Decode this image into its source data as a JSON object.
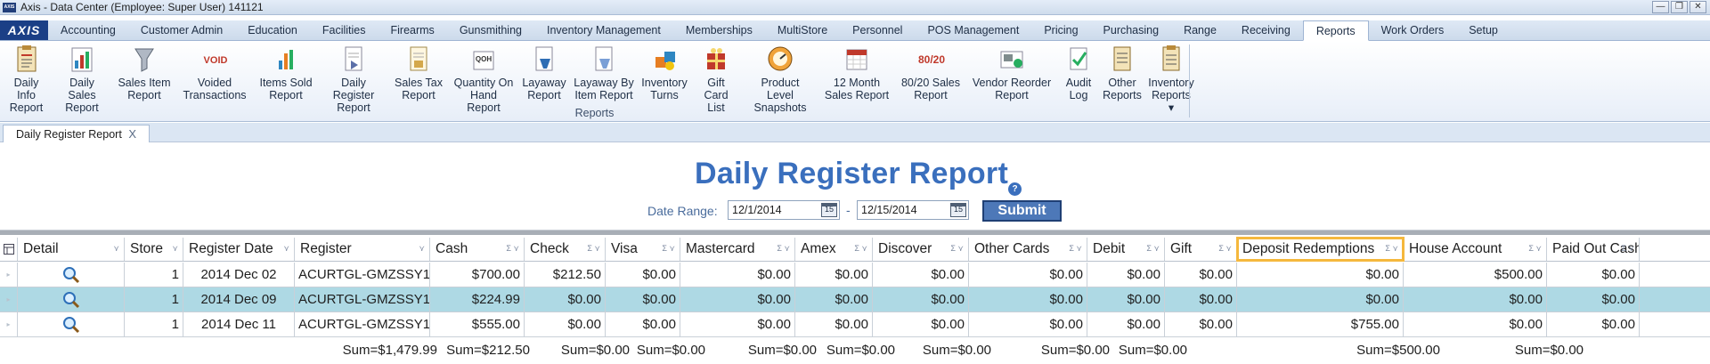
{
  "window": {
    "title": "Axis - Data Center  (Employee: Super User) 141121",
    "app_icon_text": "AXIS",
    "buttons": [
      "—",
      "❐",
      "✕"
    ]
  },
  "menu": {
    "logo": "AXIS",
    "tabs": [
      "Accounting",
      "Customer Admin",
      "Education",
      "Facilities",
      "Firearms",
      "Gunsmithing",
      "Inventory Management",
      "Memberships",
      "MultiStore",
      "Personnel",
      "POS Management",
      "Pricing",
      "Purchasing",
      "Range",
      "Receiving",
      "Reports",
      "Work Orders",
      "Setup"
    ],
    "active_tab": "Reports"
  },
  "ribbon": {
    "group_label": "Reports",
    "items": [
      {
        "label": "Daily Info\nReport",
        "icon": "report-clipboard-icon"
      },
      {
        "label": "Daily Sales\nReport",
        "icon": "bar-chart-icon"
      },
      {
        "label": "Sales Item\nReport",
        "icon": "funnel-icon"
      },
      {
        "label": "Voided\nTransactions",
        "icon": "void-stamp-icon",
        "icon_text": "VOID"
      },
      {
        "label": "Items Sold\nReport",
        "icon": "items-chart-icon"
      },
      {
        "label": "Daily Register\nReport",
        "icon": "register-document-icon"
      },
      {
        "label": "Sales Tax\nReport",
        "icon": "tax-document-icon"
      },
      {
        "label": "Quantity On\nHand Report",
        "icon": "qoh-icon",
        "icon_text": "QOH"
      },
      {
        "label": "Layaway\nReport",
        "icon": "layaway-icon"
      },
      {
        "label": "Layaway By\nItem Report",
        "icon": "layaway-item-icon"
      },
      {
        "label": "Inventory\nTurns",
        "icon": "inventory-turns-icon"
      },
      {
        "label": "Gift Card\nList",
        "icon": "gift-card-icon"
      },
      {
        "label": "Product Level\nSnapshots",
        "icon": "snapshot-gauge-icon"
      },
      {
        "label": "12 Month\nSales Report",
        "icon": "calendar-icon"
      },
      {
        "label": "80/20 Sales\nReport",
        "icon": "eighty-twenty-icon",
        "icon_text": "80/20"
      },
      {
        "label": "Vendor Reorder\nReport",
        "icon": "vendor-reorder-icon"
      },
      {
        "label": "Audit\nLog",
        "icon": "audit-check-icon"
      },
      {
        "label": "Other\nReports",
        "icon": "other-reports-icon"
      },
      {
        "label": "Inventory\nReports ▾",
        "icon": "inventory-reports-icon"
      }
    ]
  },
  "doc_tab": {
    "label": "Daily Register Report",
    "close": "X"
  },
  "report": {
    "title": "Daily Register Report",
    "help": "?",
    "date_range_label": "Date Range:",
    "date_from": "12/1/2014",
    "date_to": "12/15/2014",
    "calendar_day": "15",
    "dash": "-",
    "submit": "Submit"
  },
  "grid": {
    "columns": [
      "Detail",
      "Store",
      "Register Date",
      "Register",
      "Cash",
      "Check",
      "Visa",
      "Mastercard",
      "Amex",
      "Discover",
      "Other Cards",
      "Debit",
      "Gift",
      "Deposit Redemptions",
      "House Account",
      "Paid Out Cash"
    ],
    "highlighted_column": "Deposit Redemptions",
    "rows": [
      {
        "store": "1",
        "date": "2014 Dec 02",
        "register": "ACURTGL-GMZSSY1",
        "cash": "$700.00",
        "check": "$212.50",
        "visa": "$0.00",
        "mastercard": "$0.00",
        "amex": "$0.00",
        "discover": "$0.00",
        "other": "$0.00",
        "debit": "$0.00",
        "gift": "$0.00",
        "deposit": "$0.00",
        "house": "$500.00",
        "paidout": "$0.00",
        "selected": false
      },
      {
        "store": "1",
        "date": "2014 Dec 09",
        "register": "ACURTGL-GMZSSY1",
        "cash": "$224.99",
        "check": "$0.00",
        "visa": "$0.00",
        "mastercard": "$0.00",
        "amex": "$0.00",
        "discover": "$0.00",
        "other": "$0.00",
        "debit": "$0.00",
        "gift": "$0.00",
        "deposit": "$0.00",
        "house": "$0.00",
        "paidout": "$0.00",
        "selected": true
      },
      {
        "store": "1",
        "date": "2014 Dec 11",
        "register": "ACURTGL-GMZSSY1",
        "cash": "$555.00",
        "check": "$0.00",
        "visa": "$0.00",
        "mastercard": "$0.00",
        "amex": "$0.00",
        "discover": "$0.00",
        "other": "$0.00",
        "debit": "$0.00",
        "gift": "$0.00",
        "deposit": "$755.00",
        "house": "$0.00",
        "paidout": "$0.00",
        "selected": false
      }
    ],
    "sums": {
      "cash": "Sum=$1,479.99",
      "check": "Sum=$212.50",
      "visa": "Sum=$0.00",
      "mastercard": "Sum=$0.00",
      "amex": "Sum=$0.00",
      "discover": "Sum=$0.00",
      "other": "Sum=$0.00",
      "debit": "Sum=$0.00",
      "gift": "Sum=$0.00",
      "house": "Sum=$500.00",
      "paidout": "Sum=$0.00"
    }
  }
}
